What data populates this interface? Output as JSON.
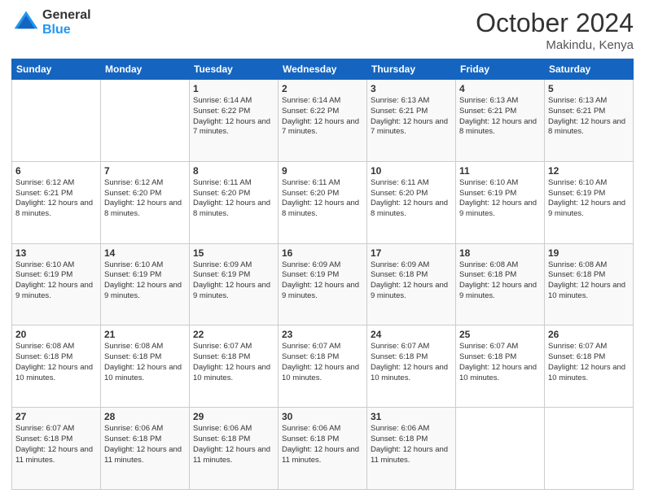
{
  "logo": {
    "general": "General",
    "blue": "Blue"
  },
  "header": {
    "month": "October 2024",
    "location": "Makindu, Kenya"
  },
  "weekdays": [
    "Sunday",
    "Monday",
    "Tuesday",
    "Wednesday",
    "Thursday",
    "Friday",
    "Saturday"
  ],
  "weeks": [
    [
      {
        "day": "",
        "sunrise": "",
        "sunset": "",
        "daylight": ""
      },
      {
        "day": "",
        "sunrise": "",
        "sunset": "",
        "daylight": ""
      },
      {
        "day": "1",
        "sunrise": "Sunrise: 6:14 AM",
        "sunset": "Sunset: 6:22 PM",
        "daylight": "Daylight: 12 hours and 7 minutes."
      },
      {
        "day": "2",
        "sunrise": "Sunrise: 6:14 AM",
        "sunset": "Sunset: 6:22 PM",
        "daylight": "Daylight: 12 hours and 7 minutes."
      },
      {
        "day": "3",
        "sunrise": "Sunrise: 6:13 AM",
        "sunset": "Sunset: 6:21 PM",
        "daylight": "Daylight: 12 hours and 7 minutes."
      },
      {
        "day": "4",
        "sunrise": "Sunrise: 6:13 AM",
        "sunset": "Sunset: 6:21 PM",
        "daylight": "Daylight: 12 hours and 8 minutes."
      },
      {
        "day": "5",
        "sunrise": "Sunrise: 6:13 AM",
        "sunset": "Sunset: 6:21 PM",
        "daylight": "Daylight: 12 hours and 8 minutes."
      }
    ],
    [
      {
        "day": "6",
        "sunrise": "Sunrise: 6:12 AM",
        "sunset": "Sunset: 6:21 PM",
        "daylight": "Daylight: 12 hours and 8 minutes."
      },
      {
        "day": "7",
        "sunrise": "Sunrise: 6:12 AM",
        "sunset": "Sunset: 6:20 PM",
        "daylight": "Daylight: 12 hours and 8 minutes."
      },
      {
        "day": "8",
        "sunrise": "Sunrise: 6:11 AM",
        "sunset": "Sunset: 6:20 PM",
        "daylight": "Daylight: 12 hours and 8 minutes."
      },
      {
        "day": "9",
        "sunrise": "Sunrise: 6:11 AM",
        "sunset": "Sunset: 6:20 PM",
        "daylight": "Daylight: 12 hours and 8 minutes."
      },
      {
        "day": "10",
        "sunrise": "Sunrise: 6:11 AM",
        "sunset": "Sunset: 6:20 PM",
        "daylight": "Daylight: 12 hours and 8 minutes."
      },
      {
        "day": "11",
        "sunrise": "Sunrise: 6:10 AM",
        "sunset": "Sunset: 6:19 PM",
        "daylight": "Daylight: 12 hours and 9 minutes."
      },
      {
        "day": "12",
        "sunrise": "Sunrise: 6:10 AM",
        "sunset": "Sunset: 6:19 PM",
        "daylight": "Daylight: 12 hours and 9 minutes."
      }
    ],
    [
      {
        "day": "13",
        "sunrise": "Sunrise: 6:10 AM",
        "sunset": "Sunset: 6:19 PM",
        "daylight": "Daylight: 12 hours and 9 minutes."
      },
      {
        "day": "14",
        "sunrise": "Sunrise: 6:10 AM",
        "sunset": "Sunset: 6:19 PM",
        "daylight": "Daylight: 12 hours and 9 minutes."
      },
      {
        "day": "15",
        "sunrise": "Sunrise: 6:09 AM",
        "sunset": "Sunset: 6:19 PM",
        "daylight": "Daylight: 12 hours and 9 minutes."
      },
      {
        "day": "16",
        "sunrise": "Sunrise: 6:09 AM",
        "sunset": "Sunset: 6:19 PM",
        "daylight": "Daylight: 12 hours and 9 minutes."
      },
      {
        "day": "17",
        "sunrise": "Sunrise: 6:09 AM",
        "sunset": "Sunset: 6:18 PM",
        "daylight": "Daylight: 12 hours and 9 minutes."
      },
      {
        "day": "18",
        "sunrise": "Sunrise: 6:08 AM",
        "sunset": "Sunset: 6:18 PM",
        "daylight": "Daylight: 12 hours and 9 minutes."
      },
      {
        "day": "19",
        "sunrise": "Sunrise: 6:08 AM",
        "sunset": "Sunset: 6:18 PM",
        "daylight": "Daylight: 12 hours and 10 minutes."
      }
    ],
    [
      {
        "day": "20",
        "sunrise": "Sunrise: 6:08 AM",
        "sunset": "Sunset: 6:18 PM",
        "daylight": "Daylight: 12 hours and 10 minutes."
      },
      {
        "day": "21",
        "sunrise": "Sunrise: 6:08 AM",
        "sunset": "Sunset: 6:18 PM",
        "daylight": "Daylight: 12 hours and 10 minutes."
      },
      {
        "day": "22",
        "sunrise": "Sunrise: 6:07 AM",
        "sunset": "Sunset: 6:18 PM",
        "daylight": "Daylight: 12 hours and 10 minutes."
      },
      {
        "day": "23",
        "sunrise": "Sunrise: 6:07 AM",
        "sunset": "Sunset: 6:18 PM",
        "daylight": "Daylight: 12 hours and 10 minutes."
      },
      {
        "day": "24",
        "sunrise": "Sunrise: 6:07 AM",
        "sunset": "Sunset: 6:18 PM",
        "daylight": "Daylight: 12 hours and 10 minutes."
      },
      {
        "day": "25",
        "sunrise": "Sunrise: 6:07 AM",
        "sunset": "Sunset: 6:18 PM",
        "daylight": "Daylight: 12 hours and 10 minutes."
      },
      {
        "day": "26",
        "sunrise": "Sunrise: 6:07 AM",
        "sunset": "Sunset: 6:18 PM",
        "daylight": "Daylight: 12 hours and 10 minutes."
      }
    ],
    [
      {
        "day": "27",
        "sunrise": "Sunrise: 6:07 AM",
        "sunset": "Sunset: 6:18 PM",
        "daylight": "Daylight: 12 hours and 11 minutes."
      },
      {
        "day": "28",
        "sunrise": "Sunrise: 6:06 AM",
        "sunset": "Sunset: 6:18 PM",
        "daylight": "Daylight: 12 hours and 11 minutes."
      },
      {
        "day": "29",
        "sunrise": "Sunrise: 6:06 AM",
        "sunset": "Sunset: 6:18 PM",
        "daylight": "Daylight: 12 hours and 11 minutes."
      },
      {
        "day": "30",
        "sunrise": "Sunrise: 6:06 AM",
        "sunset": "Sunset: 6:18 PM",
        "daylight": "Daylight: 12 hours and 11 minutes."
      },
      {
        "day": "31",
        "sunrise": "Sunrise: 6:06 AM",
        "sunset": "Sunset: 6:18 PM",
        "daylight": "Daylight: 12 hours and 11 minutes."
      },
      {
        "day": "",
        "sunrise": "",
        "sunset": "",
        "daylight": ""
      },
      {
        "day": "",
        "sunrise": "",
        "sunset": "",
        "daylight": ""
      }
    ]
  ]
}
